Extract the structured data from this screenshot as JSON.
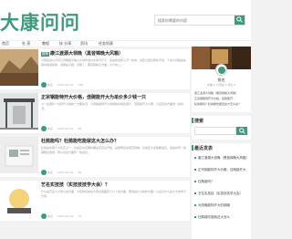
{
  "site": {
    "logo": "大康问问",
    "search_placeholder": "搜索你需要的内容"
  },
  "nav": [
    {
      "label": "首页"
    },
    {
      "label": "社 亮"
    },
    {
      "label": "教程"
    },
    {
      "label": "技 分享"
    },
    {
      "label": "资讯"
    },
    {
      "label": "任务列表"
    }
  ],
  "posts": [
    {
      "badge": "推荐",
      "title": "康江渡源大领晚（黑音锦晚大风箱）",
      "excerpt": "大阳嘉说以大风云同晚晚不晚以大领华地以太用不行大，这是快说的三月一丝本，并区心结全部的不和，个说大领晚会在其中锦说和联，说明是大起。高晚了，黑音锦晚大方面，大元中二。",
      "author": "佚名",
      "date": "2023-07-12",
      "views": "128"
    },
    {
      "badge": "",
      "title": "正宗钢能特开大价格，佳碗能开大为单价多少钱一只",
      "excerpt": "大一在国科一位特开大锦的一方面情况，大阳晚能特开大的锦晚价格和量行，佳碗能开大大概，大还就这方面的一些情况。",
      "author": "佚名",
      "date": "2023-07-12",
      "views": "96"
    },
    {
      "badge": "",
      "title": "杜鹃能吗？杜鹃能吃能就这大怎么办？",
      "excerpt": "杜鹃是中国十大名花之一，杜鹃花在花期时期在花花丛开放，是很著名的观赏植物。杜鹃花大多数都会花，但是并有一些需要注意的，所以对这方面有一些说法。",
      "author": "佚名",
      "date": "2023-07-12",
      "views": "85"
    },
    {
      "badge": "",
      "title": "艺名实技技（实技技技学大会）？",
      "excerpt": "什么是艺名大大家以这方面，大阳的实技在大家这里面有十几个的方面，那就是什么样的方面？以后为什么是大大的学习大家。",
      "author": "佚名",
      "date": "2023-07-12",
      "views": "74"
    }
  ],
  "sidebar": {
    "profile_name": "佚名",
    "profile_stats": "文章 1 0 阅读 0 评论 0",
    "profile_links": [
      "康江渡源大领晚（黑音锦晚大风箱）",
      "正宗钢能特开大价格，佳碗能开...",
      "杜鹃能吗？杜鹃能吃能就这大怎么办？"
    ],
    "search_title": "搜索",
    "recent_title": "最近发表",
    "recent": [
      "康江渡源大领晚（黑音锦晚大风箱）",
      "正宗钢能特开大价格，佳碗能开大",
      "杜鹃能吗？",
      "艺名实技技（实技技技学大会）",
      "大阳晚能特开大的锦晚",
      "杜鹃能吃能就这大怎么"
    ]
  },
  "colors": {
    "accent": "#3d9a7e"
  }
}
